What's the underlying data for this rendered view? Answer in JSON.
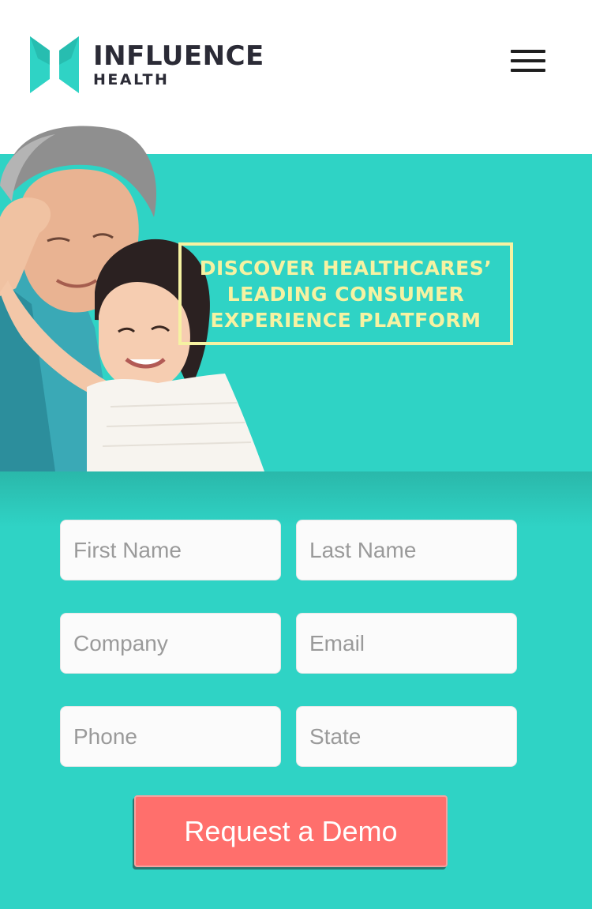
{
  "brand": {
    "name_line1": "INFLUENCE",
    "name_line2": "HEALTH",
    "logo_color": "#2fd3c5",
    "text_color": "#2b2b36"
  },
  "header": {
    "menu_icon": "hamburger-menu-icon"
  },
  "hero": {
    "background_color": "#2fd3c5",
    "headline_color": "#f6f2a2",
    "headline_lines": [
      "DISCOVER HEALTHCARES’",
      "LEADING CONSUMER",
      "EXPERIENCE PLATFORM"
    ]
  },
  "form": {
    "first_name": {
      "placeholder": "First Name",
      "value": ""
    },
    "last_name": {
      "placeholder": "Last Name",
      "value": ""
    },
    "company": {
      "placeholder": "Company",
      "value": ""
    },
    "email": {
      "placeholder": "Email",
      "value": ""
    },
    "phone": {
      "placeholder": "Phone",
      "value": ""
    },
    "state": {
      "placeholder": "State",
      "value": ""
    },
    "submit_label": "Request a Demo",
    "submit_color": "#ff6f6c"
  }
}
